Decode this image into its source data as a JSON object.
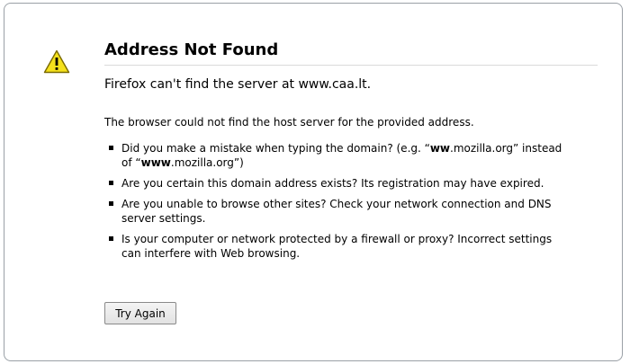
{
  "error": {
    "title": "Address Not Found",
    "short_desc": "Firefox can't find the server at www.caa.lt.",
    "intro": "The browser could not find the host server for the provided address.",
    "suggestions": [
      {
        "parts": [
          "Did you make a mistake when typing the domain? (e.g. “",
          "ww",
          ".mozilla.org” instead of “",
          "www",
          ".mozilla.org”)"
        ]
      },
      {
        "text": "Are you certain this domain address exists? Its registration may have expired."
      },
      {
        "text": "Are you unable to browse other sites? Check your network connection and DNS server settings."
      },
      {
        "text": "Is your computer or network protected by a firewall or proxy? Incorrect settings can interfere with Web browsing."
      }
    ],
    "retry_label": "Try Again"
  },
  "colors": {
    "warning_fill": "#f5e11c",
    "warning_stroke": "#7a6a00"
  },
  "icons": {
    "warning": "warning-icon"
  }
}
